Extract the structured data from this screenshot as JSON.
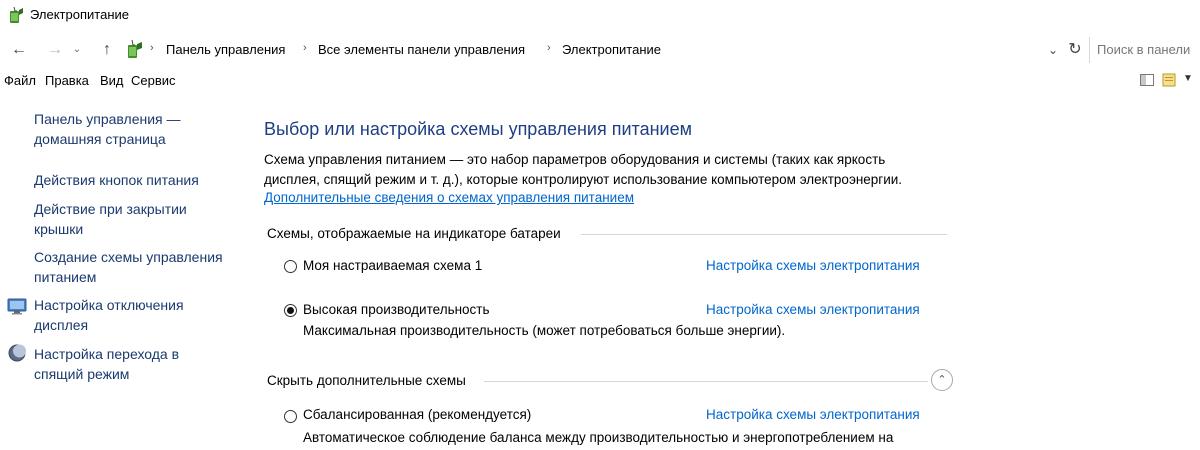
{
  "window": {
    "title": "Электропитание"
  },
  "address": {
    "crumbs": [
      "Панель управления",
      "Все элементы панели управления",
      "Электропитание"
    ],
    "separator": "›"
  },
  "search": {
    "placeholder": "Поиск в панели"
  },
  "menu": [
    "Файл",
    "Правка",
    "Вид",
    "Сервис"
  ],
  "sidebar": {
    "home_line1": "Панель управления —",
    "home_line2": "домашняя страница",
    "items": [
      {
        "line1": "Действия кнопок питания",
        "line2": ""
      },
      {
        "line1": "Действие при закрытии",
        "line2": "крышки"
      },
      {
        "line1": "Создание схемы управления",
        "line2": "питанием"
      },
      {
        "line1": "Настройка отключения",
        "line2": "дисплея",
        "icon": "display-icon"
      },
      {
        "line1": "Настройка перехода в",
        "line2": "спящий режим",
        "icon": "sleep-moon-icon"
      }
    ]
  },
  "main": {
    "heading": "Выбор или настройка схемы управления питанием",
    "description_line1": "Схема управления питанием — это набор параметров оборудования и системы (таких как яркость",
    "description_line2": "дисплея, спящий режим и т. д.), которые контролируют использование компьютером электроэнергии.",
    "more_info_link": "Дополнительные сведения о схемах управления питанием",
    "group_shown_label": "Схемы, отображаемые на индикаторе батареи",
    "group_hidden_label": "Скрыть дополнительные схемы",
    "plans": [
      {
        "name": "Моя настраиваемая схема 1",
        "link": "Настройка схемы электропитания",
        "description": "",
        "selected": false
      },
      {
        "name": "Высокая производительность",
        "link": "Настройка схемы электропитания",
        "description": "Максимальная производительность (может потребоваться больше энергии).",
        "selected": true
      },
      {
        "name": "Сбалансированная (рекомендуется)",
        "link": "Настройка схемы электропитания",
        "description": "Автоматическое соблюдение баланса между производительностью и энергопотреблением на",
        "selected": false
      }
    ]
  },
  "colors": {
    "heading": "#1e3f82",
    "link": "#0066cc",
    "sidebar_link": "#1a3a6e"
  }
}
